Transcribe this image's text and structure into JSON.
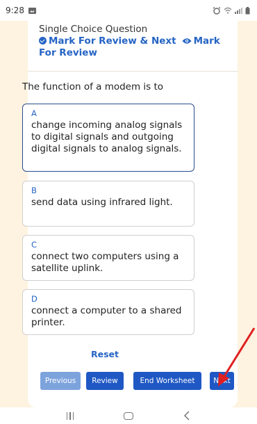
{
  "status_bar": {
    "time": "9:28"
  },
  "header": {
    "question_type": "Single Choice Question",
    "mark_review_next_label": "Mark For Review & Next",
    "mark_review_label": "Mark For Review"
  },
  "question": {
    "text": "The function of a modem is to"
  },
  "options": [
    {
      "letter": "A",
      "text": "change incoming analog signals to digital signals and outgoing digital signals to analog signals.",
      "selected": true
    },
    {
      "letter": "B",
      "text": "send data using infrared light.",
      "selected": false
    },
    {
      "letter": "C",
      "text": "connect two computers using a satellite uplink.",
      "selected": false
    },
    {
      "letter": "D",
      "text": "connect a computer to a shared printer.",
      "selected": false
    }
  ],
  "actions": {
    "reset_label": "Reset",
    "previous_label": "Previous",
    "review_label": "Review",
    "end_worksheet_label": "End Worksheet",
    "next_label": "Next"
  },
  "colors": {
    "accent": "#1f58c4",
    "link": "#2564c4",
    "disabled_button": "#7da3dd",
    "background": "#fdf3e0",
    "annotation_arrow": "#e02020"
  },
  "icons": [
    "image-icon",
    "alarm-icon",
    "wifi-icon",
    "signal-icon",
    "battery-icon",
    "check-circle-icon",
    "eye-icon",
    "recents-icon",
    "home-icon",
    "back-icon",
    "annotation-arrow-icon"
  ]
}
